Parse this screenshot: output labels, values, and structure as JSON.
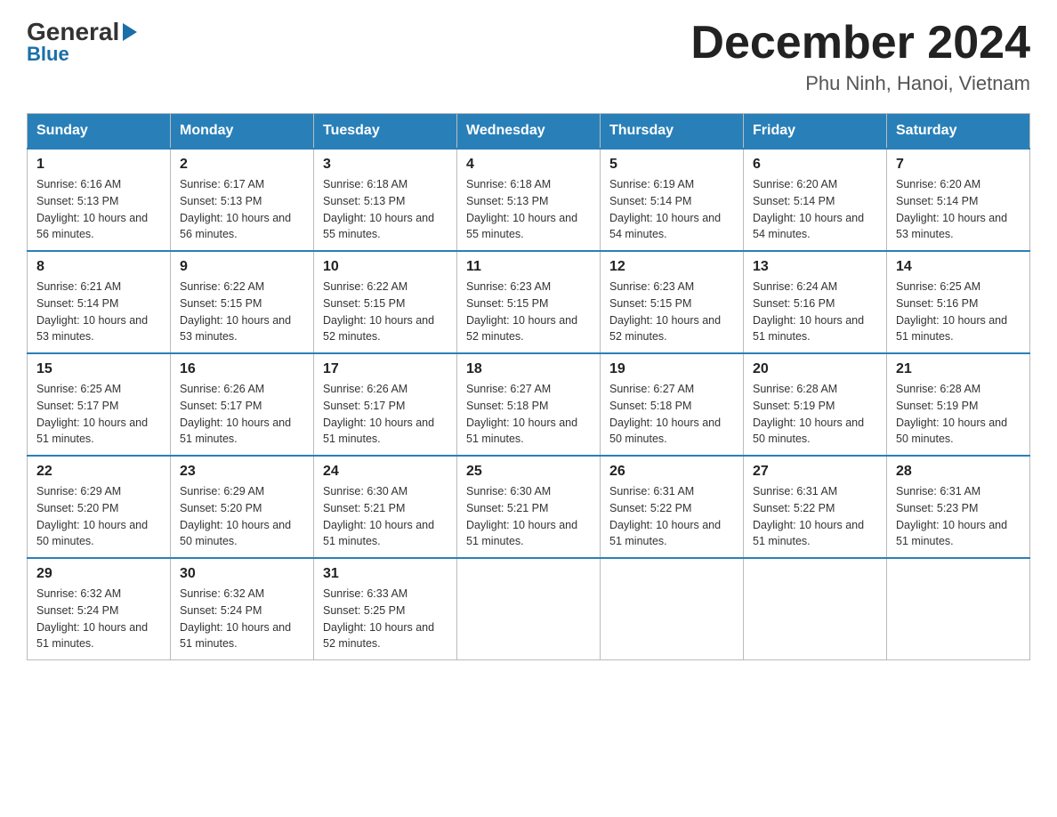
{
  "header": {
    "logo_general": "General",
    "logo_blue": "Blue",
    "month_title": "December 2024",
    "location": "Phu Ninh, Hanoi, Vietnam"
  },
  "calendar": {
    "days_of_week": [
      "Sunday",
      "Monday",
      "Tuesday",
      "Wednesday",
      "Thursday",
      "Friday",
      "Saturday"
    ],
    "weeks": [
      [
        {
          "day": "1",
          "sunrise": "6:16 AM",
          "sunset": "5:13 PM",
          "daylight": "10 hours and 56 minutes."
        },
        {
          "day": "2",
          "sunrise": "6:17 AM",
          "sunset": "5:13 PM",
          "daylight": "10 hours and 56 minutes."
        },
        {
          "day": "3",
          "sunrise": "6:18 AM",
          "sunset": "5:13 PM",
          "daylight": "10 hours and 55 minutes."
        },
        {
          "day": "4",
          "sunrise": "6:18 AM",
          "sunset": "5:13 PM",
          "daylight": "10 hours and 55 minutes."
        },
        {
          "day": "5",
          "sunrise": "6:19 AM",
          "sunset": "5:14 PM",
          "daylight": "10 hours and 54 minutes."
        },
        {
          "day": "6",
          "sunrise": "6:20 AM",
          "sunset": "5:14 PM",
          "daylight": "10 hours and 54 minutes."
        },
        {
          "day": "7",
          "sunrise": "6:20 AM",
          "sunset": "5:14 PM",
          "daylight": "10 hours and 53 minutes."
        }
      ],
      [
        {
          "day": "8",
          "sunrise": "6:21 AM",
          "sunset": "5:14 PM",
          "daylight": "10 hours and 53 minutes."
        },
        {
          "day": "9",
          "sunrise": "6:22 AM",
          "sunset": "5:15 PM",
          "daylight": "10 hours and 53 minutes."
        },
        {
          "day": "10",
          "sunrise": "6:22 AM",
          "sunset": "5:15 PM",
          "daylight": "10 hours and 52 minutes."
        },
        {
          "day": "11",
          "sunrise": "6:23 AM",
          "sunset": "5:15 PM",
          "daylight": "10 hours and 52 minutes."
        },
        {
          "day": "12",
          "sunrise": "6:23 AM",
          "sunset": "5:15 PM",
          "daylight": "10 hours and 52 minutes."
        },
        {
          "day": "13",
          "sunrise": "6:24 AM",
          "sunset": "5:16 PM",
          "daylight": "10 hours and 51 minutes."
        },
        {
          "day": "14",
          "sunrise": "6:25 AM",
          "sunset": "5:16 PM",
          "daylight": "10 hours and 51 minutes."
        }
      ],
      [
        {
          "day": "15",
          "sunrise": "6:25 AM",
          "sunset": "5:17 PM",
          "daylight": "10 hours and 51 minutes."
        },
        {
          "day": "16",
          "sunrise": "6:26 AM",
          "sunset": "5:17 PM",
          "daylight": "10 hours and 51 minutes."
        },
        {
          "day": "17",
          "sunrise": "6:26 AM",
          "sunset": "5:17 PM",
          "daylight": "10 hours and 51 minutes."
        },
        {
          "day": "18",
          "sunrise": "6:27 AM",
          "sunset": "5:18 PM",
          "daylight": "10 hours and 51 minutes."
        },
        {
          "day": "19",
          "sunrise": "6:27 AM",
          "sunset": "5:18 PM",
          "daylight": "10 hours and 50 minutes."
        },
        {
          "day": "20",
          "sunrise": "6:28 AM",
          "sunset": "5:19 PM",
          "daylight": "10 hours and 50 minutes."
        },
        {
          "day": "21",
          "sunrise": "6:28 AM",
          "sunset": "5:19 PM",
          "daylight": "10 hours and 50 minutes."
        }
      ],
      [
        {
          "day": "22",
          "sunrise": "6:29 AM",
          "sunset": "5:20 PM",
          "daylight": "10 hours and 50 minutes."
        },
        {
          "day": "23",
          "sunrise": "6:29 AM",
          "sunset": "5:20 PM",
          "daylight": "10 hours and 50 minutes."
        },
        {
          "day": "24",
          "sunrise": "6:30 AM",
          "sunset": "5:21 PM",
          "daylight": "10 hours and 51 minutes."
        },
        {
          "day": "25",
          "sunrise": "6:30 AM",
          "sunset": "5:21 PM",
          "daylight": "10 hours and 51 minutes."
        },
        {
          "day": "26",
          "sunrise": "6:31 AM",
          "sunset": "5:22 PM",
          "daylight": "10 hours and 51 minutes."
        },
        {
          "day": "27",
          "sunrise": "6:31 AM",
          "sunset": "5:22 PM",
          "daylight": "10 hours and 51 minutes."
        },
        {
          "day": "28",
          "sunrise": "6:31 AM",
          "sunset": "5:23 PM",
          "daylight": "10 hours and 51 minutes."
        }
      ],
      [
        {
          "day": "29",
          "sunrise": "6:32 AM",
          "sunset": "5:24 PM",
          "daylight": "10 hours and 51 minutes."
        },
        {
          "day": "30",
          "sunrise": "6:32 AM",
          "sunset": "5:24 PM",
          "daylight": "10 hours and 51 minutes."
        },
        {
          "day": "31",
          "sunrise": "6:33 AM",
          "sunset": "5:25 PM",
          "daylight": "10 hours and 52 minutes."
        },
        null,
        null,
        null,
        null
      ]
    ]
  }
}
